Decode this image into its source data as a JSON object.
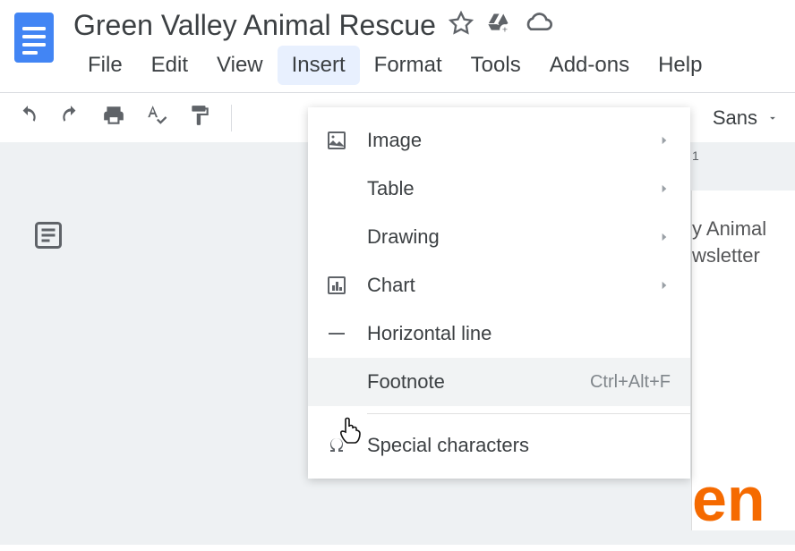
{
  "title": "Green Valley Animal Rescue",
  "menu": {
    "file": "File",
    "edit": "Edit",
    "view": "View",
    "insert": "Insert",
    "format": "Format",
    "tools": "Tools",
    "addons": "Add-ons",
    "help": "Help"
  },
  "toolbar": {
    "font": "Sans"
  },
  "ruler": {
    "mark1": "1"
  },
  "doc": {
    "line1": "y Animal",
    "line2": "wsletter",
    "orange": "en"
  },
  "dropdown": {
    "image": "Image",
    "table": "Table",
    "drawing": "Drawing",
    "chart": "Chart",
    "hline": "Horizontal line",
    "footnote": "Footnote",
    "footnote_shortcut": "Ctrl+Alt+F",
    "special": "Special characters"
  }
}
